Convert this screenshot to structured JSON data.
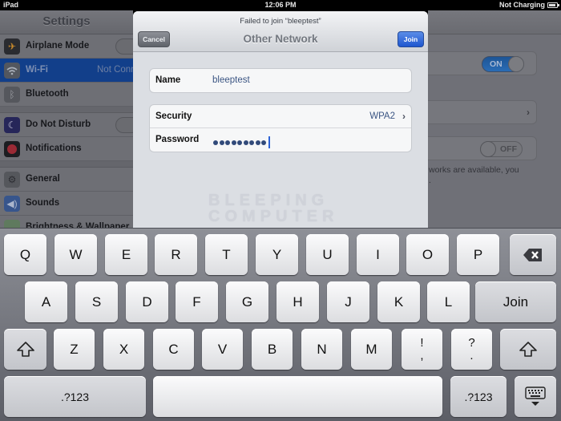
{
  "status_bar": {
    "device": "iPad",
    "time": "12:06 PM",
    "battery_status": "Not Charging",
    "battery_icon": "battery-icon"
  },
  "settings_sidebar": {
    "title": "Settings",
    "items": [
      {
        "label": "Airplane Mode",
        "icon": "airplane-icon",
        "value": "",
        "has_toggle": true
      },
      {
        "label": "Wi-Fi",
        "icon": "wifi-icon",
        "value": "Not Connected",
        "selected": true
      },
      {
        "label": "Bluetooth",
        "icon": "bluetooth-icon",
        "value": ""
      },
      {
        "label": "Do Not Disturb",
        "icon": "moon-icon",
        "value": "",
        "has_toggle": true
      },
      {
        "label": "Notifications",
        "icon": "notifications-icon",
        "value": ""
      },
      {
        "label": "General",
        "icon": "gear-icon",
        "value": ""
      },
      {
        "label": "Sounds",
        "icon": "speaker-icon",
        "value": ""
      },
      {
        "label": "Brightness & Wallpaper",
        "icon": "brightness-icon",
        "value": ""
      }
    ],
    "visible_value_text": "Not Con"
  },
  "detail_pane": {
    "wifi_toggle": "ON",
    "ask_to_join_toggle": "OFF",
    "note": "works are available, you",
    "note_line2": "."
  },
  "modal": {
    "prompt": "Failed to join “bleeptest”",
    "title": "Other Network",
    "cancel_label": "Cancel",
    "join_label": "Join",
    "name_label": "Name",
    "name_value": "bleeptest",
    "security_label": "Security",
    "security_value": "WPA2",
    "password_label": "Password",
    "password_length": 9,
    "watermark_line1": "BLEEPING",
    "watermark_line2": "COMPUTER"
  },
  "keyboard": {
    "row1": [
      "Q",
      "W",
      "E",
      "R",
      "T",
      "Y",
      "U",
      "I",
      "O",
      "P"
    ],
    "row2": [
      "A",
      "S",
      "D",
      "F",
      "G",
      "H",
      "J",
      "K",
      "L"
    ],
    "row3": [
      "Z",
      "X",
      "C",
      "V",
      "B",
      "N",
      "M"
    ],
    "exclaim_top": "!",
    "exclaim_bottom": ",",
    "question_top": "?",
    "question_bottom": ".",
    "return_label": "Join",
    "numbers_label": ".?123",
    "backspace_icon": "backspace-icon",
    "shift_icon": "shift-icon",
    "dismiss_icon": "keyboard-dismiss-icon"
  }
}
